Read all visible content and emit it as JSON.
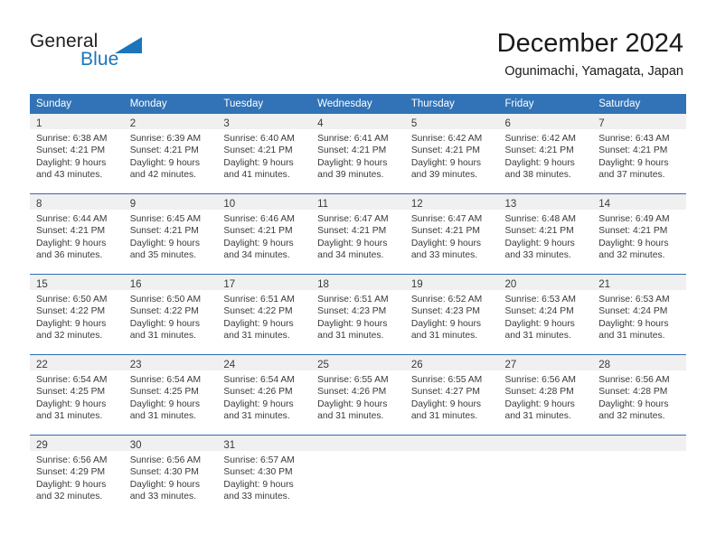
{
  "logo": {
    "word_top": "General",
    "word_bottom": "Blue",
    "mark": "triangle-icon"
  },
  "header": {
    "title": "December 2024",
    "subtitle": "Ogunimachi, Yamagata, Japan"
  },
  "colors": {
    "header_blue": "#3173b6",
    "logo_blue": "#1b75bb",
    "daynum_band": "#f0f0f0",
    "row_divider": "#2f6fae",
    "text": "#3a3a3a"
  },
  "weekdays": [
    "Sunday",
    "Monday",
    "Tuesday",
    "Wednesday",
    "Thursday",
    "Friday",
    "Saturday"
  ],
  "weeks": [
    [
      {
        "day": "1",
        "sunrise": "Sunrise: 6:38 AM",
        "sunset": "Sunset: 4:21 PM",
        "daylight1": "Daylight: 9 hours",
        "daylight2": "and 43 minutes."
      },
      {
        "day": "2",
        "sunrise": "Sunrise: 6:39 AM",
        "sunset": "Sunset: 4:21 PM",
        "daylight1": "Daylight: 9 hours",
        "daylight2": "and 42 minutes."
      },
      {
        "day": "3",
        "sunrise": "Sunrise: 6:40 AM",
        "sunset": "Sunset: 4:21 PM",
        "daylight1": "Daylight: 9 hours",
        "daylight2": "and 41 minutes."
      },
      {
        "day": "4",
        "sunrise": "Sunrise: 6:41 AM",
        "sunset": "Sunset: 4:21 PM",
        "daylight1": "Daylight: 9 hours",
        "daylight2": "and 39 minutes."
      },
      {
        "day": "5",
        "sunrise": "Sunrise: 6:42 AM",
        "sunset": "Sunset: 4:21 PM",
        "daylight1": "Daylight: 9 hours",
        "daylight2": "and 39 minutes."
      },
      {
        "day": "6",
        "sunrise": "Sunrise: 6:42 AM",
        "sunset": "Sunset: 4:21 PM",
        "daylight1": "Daylight: 9 hours",
        "daylight2": "and 38 minutes."
      },
      {
        "day": "7",
        "sunrise": "Sunrise: 6:43 AM",
        "sunset": "Sunset: 4:21 PM",
        "daylight1": "Daylight: 9 hours",
        "daylight2": "and 37 minutes."
      }
    ],
    [
      {
        "day": "8",
        "sunrise": "Sunrise: 6:44 AM",
        "sunset": "Sunset: 4:21 PM",
        "daylight1": "Daylight: 9 hours",
        "daylight2": "and 36 minutes."
      },
      {
        "day": "9",
        "sunrise": "Sunrise: 6:45 AM",
        "sunset": "Sunset: 4:21 PM",
        "daylight1": "Daylight: 9 hours",
        "daylight2": "and 35 minutes."
      },
      {
        "day": "10",
        "sunrise": "Sunrise: 6:46 AM",
        "sunset": "Sunset: 4:21 PM",
        "daylight1": "Daylight: 9 hours",
        "daylight2": "and 34 minutes."
      },
      {
        "day": "11",
        "sunrise": "Sunrise: 6:47 AM",
        "sunset": "Sunset: 4:21 PM",
        "daylight1": "Daylight: 9 hours",
        "daylight2": "and 34 minutes."
      },
      {
        "day": "12",
        "sunrise": "Sunrise: 6:47 AM",
        "sunset": "Sunset: 4:21 PM",
        "daylight1": "Daylight: 9 hours",
        "daylight2": "and 33 minutes."
      },
      {
        "day": "13",
        "sunrise": "Sunrise: 6:48 AM",
        "sunset": "Sunset: 4:21 PM",
        "daylight1": "Daylight: 9 hours",
        "daylight2": "and 33 minutes."
      },
      {
        "day": "14",
        "sunrise": "Sunrise: 6:49 AM",
        "sunset": "Sunset: 4:21 PM",
        "daylight1": "Daylight: 9 hours",
        "daylight2": "and 32 minutes."
      }
    ],
    [
      {
        "day": "15",
        "sunrise": "Sunrise: 6:50 AM",
        "sunset": "Sunset: 4:22 PM",
        "daylight1": "Daylight: 9 hours",
        "daylight2": "and 32 minutes."
      },
      {
        "day": "16",
        "sunrise": "Sunrise: 6:50 AM",
        "sunset": "Sunset: 4:22 PM",
        "daylight1": "Daylight: 9 hours",
        "daylight2": "and 31 minutes."
      },
      {
        "day": "17",
        "sunrise": "Sunrise: 6:51 AM",
        "sunset": "Sunset: 4:22 PM",
        "daylight1": "Daylight: 9 hours",
        "daylight2": "and 31 minutes."
      },
      {
        "day": "18",
        "sunrise": "Sunrise: 6:51 AM",
        "sunset": "Sunset: 4:23 PM",
        "daylight1": "Daylight: 9 hours",
        "daylight2": "and 31 minutes."
      },
      {
        "day": "19",
        "sunrise": "Sunrise: 6:52 AM",
        "sunset": "Sunset: 4:23 PM",
        "daylight1": "Daylight: 9 hours",
        "daylight2": "and 31 minutes."
      },
      {
        "day": "20",
        "sunrise": "Sunrise: 6:53 AM",
        "sunset": "Sunset: 4:24 PM",
        "daylight1": "Daylight: 9 hours",
        "daylight2": "and 31 minutes."
      },
      {
        "day": "21",
        "sunrise": "Sunrise: 6:53 AM",
        "sunset": "Sunset: 4:24 PM",
        "daylight1": "Daylight: 9 hours",
        "daylight2": "and 31 minutes."
      }
    ],
    [
      {
        "day": "22",
        "sunrise": "Sunrise: 6:54 AM",
        "sunset": "Sunset: 4:25 PM",
        "daylight1": "Daylight: 9 hours",
        "daylight2": "and 31 minutes."
      },
      {
        "day": "23",
        "sunrise": "Sunrise: 6:54 AM",
        "sunset": "Sunset: 4:25 PM",
        "daylight1": "Daylight: 9 hours",
        "daylight2": "and 31 minutes."
      },
      {
        "day": "24",
        "sunrise": "Sunrise: 6:54 AM",
        "sunset": "Sunset: 4:26 PM",
        "daylight1": "Daylight: 9 hours",
        "daylight2": "and 31 minutes."
      },
      {
        "day": "25",
        "sunrise": "Sunrise: 6:55 AM",
        "sunset": "Sunset: 4:26 PM",
        "daylight1": "Daylight: 9 hours",
        "daylight2": "and 31 minutes."
      },
      {
        "day": "26",
        "sunrise": "Sunrise: 6:55 AM",
        "sunset": "Sunset: 4:27 PM",
        "daylight1": "Daylight: 9 hours",
        "daylight2": "and 31 minutes."
      },
      {
        "day": "27",
        "sunrise": "Sunrise: 6:56 AM",
        "sunset": "Sunset: 4:28 PM",
        "daylight1": "Daylight: 9 hours",
        "daylight2": "and 31 minutes."
      },
      {
        "day": "28",
        "sunrise": "Sunrise: 6:56 AM",
        "sunset": "Sunset: 4:28 PM",
        "daylight1": "Daylight: 9 hours",
        "daylight2": "and 32 minutes."
      }
    ],
    [
      {
        "day": "29",
        "sunrise": "Sunrise: 6:56 AM",
        "sunset": "Sunset: 4:29 PM",
        "daylight1": "Daylight: 9 hours",
        "daylight2": "and 32 minutes."
      },
      {
        "day": "30",
        "sunrise": "Sunrise: 6:56 AM",
        "sunset": "Sunset: 4:30 PM",
        "daylight1": "Daylight: 9 hours",
        "daylight2": "and 33 minutes."
      },
      {
        "day": "31",
        "sunrise": "Sunrise: 6:57 AM",
        "sunset": "Sunset: 4:30 PM",
        "daylight1": "Daylight: 9 hours",
        "daylight2": "and 33 minutes."
      },
      {
        "day": "",
        "sunrise": "",
        "sunset": "",
        "daylight1": "",
        "daylight2": ""
      },
      {
        "day": "",
        "sunrise": "",
        "sunset": "",
        "daylight1": "",
        "daylight2": ""
      },
      {
        "day": "",
        "sunrise": "",
        "sunset": "",
        "daylight1": "",
        "daylight2": ""
      },
      {
        "day": "",
        "sunrise": "",
        "sunset": "",
        "daylight1": "",
        "daylight2": ""
      }
    ]
  ]
}
